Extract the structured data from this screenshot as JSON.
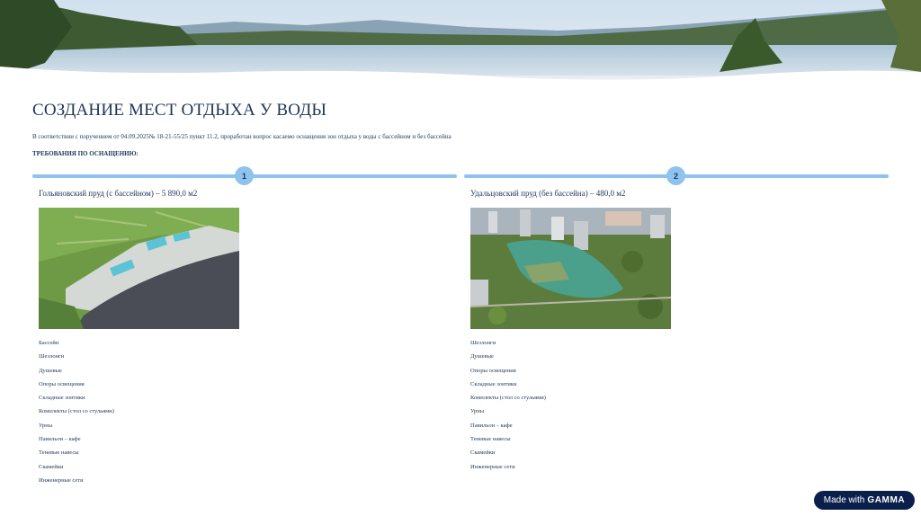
{
  "header": {
    "title": "СОЗДАНИЕ МЕСТ ОТДЫХА У ВОДЫ",
    "subtitle": "В соответствии с поручением от 04.09.2025№ 18-21-55/25 пункт 11.2, проработан вопрос касаемо оснащения зон отдыха у воды с бассейном и без бассейна",
    "requirements_heading": "ТРЕБОВАНИЯ ПО ОСНАЩЕНИЮ:"
  },
  "steps": [
    {
      "number": "1",
      "title": "Гольяновский пруд (с бассейном) – 5 890,0 м2",
      "items": [
        "Бассейн",
        "Шезлонги",
        "Душевые",
        "Опоры освещения",
        "Складные зонтики",
        "Комплекты (стол со стульями)",
        "Урны",
        "Павильон – кафе",
        "Теневые навесы",
        "Скамейки",
        "Инженерные сети"
      ]
    },
    {
      "number": "2",
      "title": "Удальцовский пруд (без бассейна) – 480,0 м2",
      "items": [
        "Шезлонги",
        "Душевые",
        "Опоры освещения",
        "Складные зонтики",
        "Комплекты (стол со стульями)",
        "Урны",
        "Павильон – кафе",
        "Теневые навесы",
        "Скамейки",
        "Инженерные сети"
      ]
    }
  ],
  "badge": {
    "prefix": "Made with",
    "brand": "GAMMA"
  },
  "colors": {
    "primary_text": "#1d3557",
    "step_accent": "#8ec3ee",
    "badge_bg": "#0b1f4d"
  }
}
